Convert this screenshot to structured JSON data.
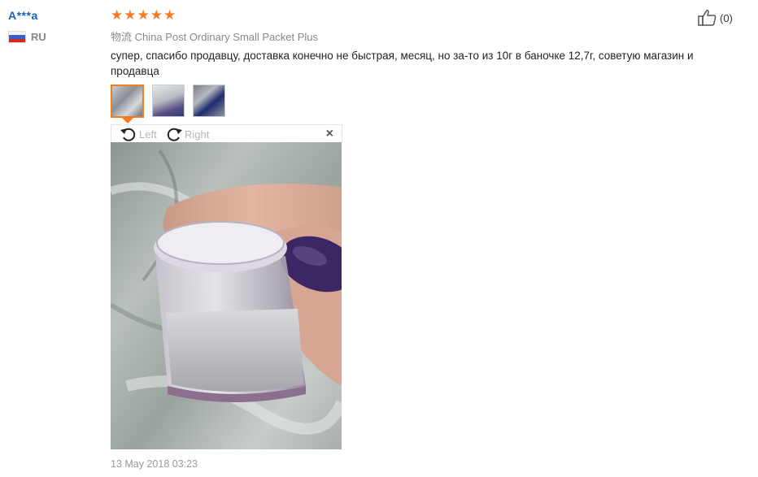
{
  "review": {
    "user_name": "A***a",
    "country_code": "RU",
    "rating": 5,
    "rating_stars": [
      "★",
      "★",
      "★",
      "★",
      "★"
    ],
    "shipping": "物流 China Post Ordinary Small Packet Plus",
    "text": "супер, спасибо продавцу, доставка конечно не быстрая, месяц, но за-то из 10г в баночке 12,7г, советую магазин и продавца",
    "date": "13 May 2018 03:23",
    "helpful_count": "(0)",
    "thumbnails_count": 3,
    "selected_thumbnail": 1
  },
  "viewer": {
    "rotate_left_label": "Left",
    "rotate_right_label": "Right",
    "close_symbol": "×"
  },
  "colors": {
    "accent": "#f47b1f",
    "username": "#1a5fb4",
    "muted": "#888888"
  },
  "icons": [
    "russia-flag-icon",
    "star-icon",
    "thumbs-up-icon",
    "rotate-left-icon",
    "rotate-right-icon",
    "close-icon"
  ]
}
